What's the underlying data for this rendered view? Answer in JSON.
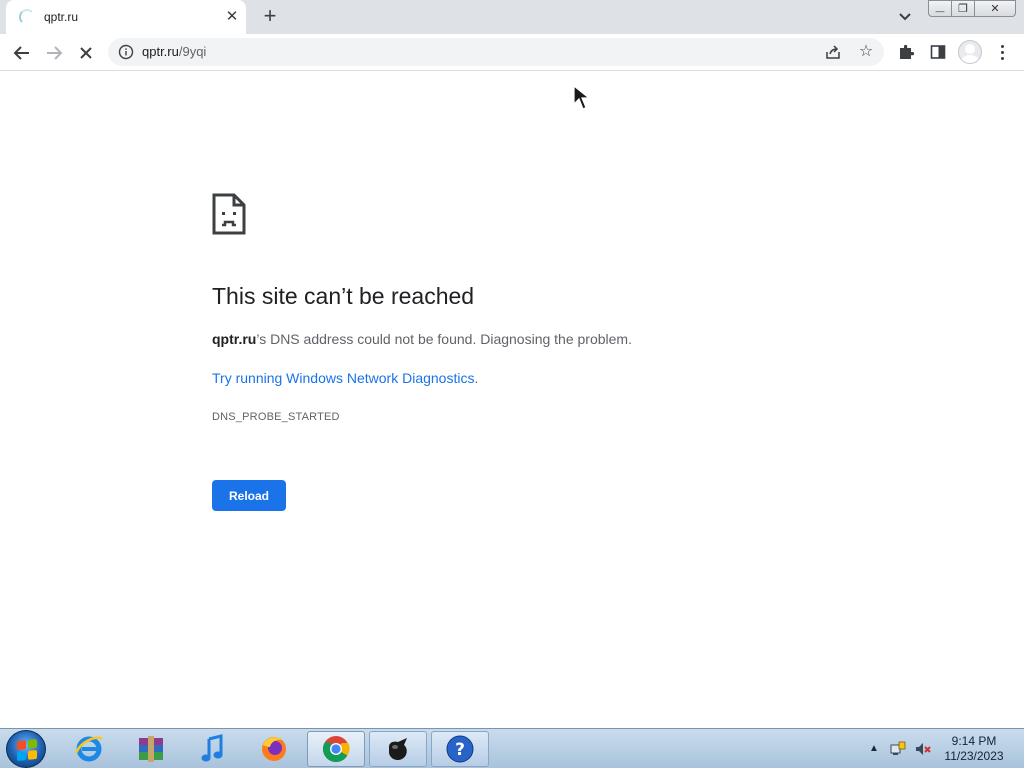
{
  "browser": {
    "tab": {
      "title": "qptr.ru",
      "close_glyph": "✕",
      "icon": "loading-spinner-icon"
    },
    "new_tab_glyph": "+",
    "address_bar": {
      "host": "qptr.ru",
      "path": "/9yqi"
    },
    "window_controls": {
      "minimize": "—",
      "restore": "❐",
      "close": "✕"
    }
  },
  "error_page": {
    "title": "This site can’t be reached",
    "description_host": "qptr.ru",
    "description_rest": "’s DNS address could not be found. Diagnosing the problem.",
    "link_text": "Try running Windows Network Diagnostics",
    "link_suffix": ".",
    "error_code": "DNS_PROBE_STARTED",
    "reload_label": "Reload"
  },
  "taskbar": {
    "apps": [
      "internet-explorer",
      "winrar",
      "itunes",
      "firefox",
      "chrome",
      "paint-app",
      "help-and-support"
    ],
    "tray_arrow": "▲",
    "clock_time": "9:14 PM",
    "clock_date": "11/23/2023"
  },
  "colors": {
    "accent": "#1a73e8",
    "tab_strip": "#dee1e6",
    "taskbar": "#b6cde3"
  }
}
